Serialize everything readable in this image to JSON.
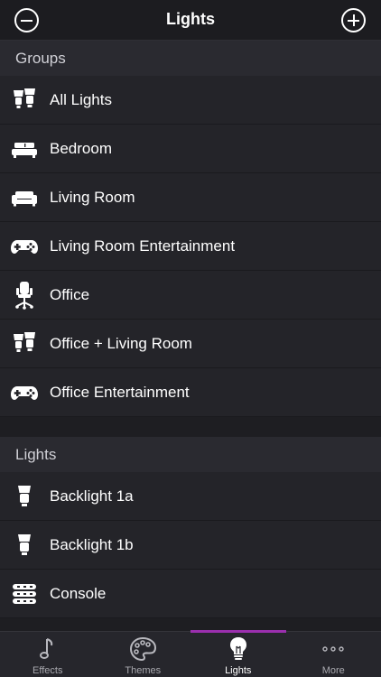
{
  "header": {
    "title": "Lights"
  },
  "groups": {
    "title": "Groups",
    "items": [
      {
        "label": "All Lights",
        "icon": "multi-bulb-icon"
      },
      {
        "label": "Bedroom",
        "icon": "bed-icon"
      },
      {
        "label": "Living Room",
        "icon": "sofa-icon"
      },
      {
        "label": "Living Room Entertainment",
        "icon": "gamepad-icon"
      },
      {
        "label": "Office",
        "icon": "office-chair-icon"
      },
      {
        "label": "Office + Living Room",
        "icon": "multi-bulb-icon"
      },
      {
        "label": "Office Entertainment",
        "icon": "gamepad-icon"
      }
    ]
  },
  "lights": {
    "title": "Lights",
    "items": [
      {
        "label": "Backlight 1a",
        "icon": "bulb-icon"
      },
      {
        "label": "Backlight 1b",
        "icon": "bulb-icon"
      },
      {
        "label": "Console",
        "icon": "lightstrip-icon"
      }
    ]
  },
  "tabs": [
    {
      "label": "Effects",
      "icon": "music-note-icon",
      "active": false
    },
    {
      "label": "Themes",
      "icon": "palette-icon",
      "active": false
    },
    {
      "label": "Lights",
      "icon": "lightbulb-icon",
      "active": true
    },
    {
      "label": "More",
      "icon": "more-dots-icon",
      "active": false
    }
  ],
  "colors": {
    "accent": "#9b2fae",
    "background": "#1e1e22",
    "row": "#242429",
    "section": "#2a2a30"
  }
}
